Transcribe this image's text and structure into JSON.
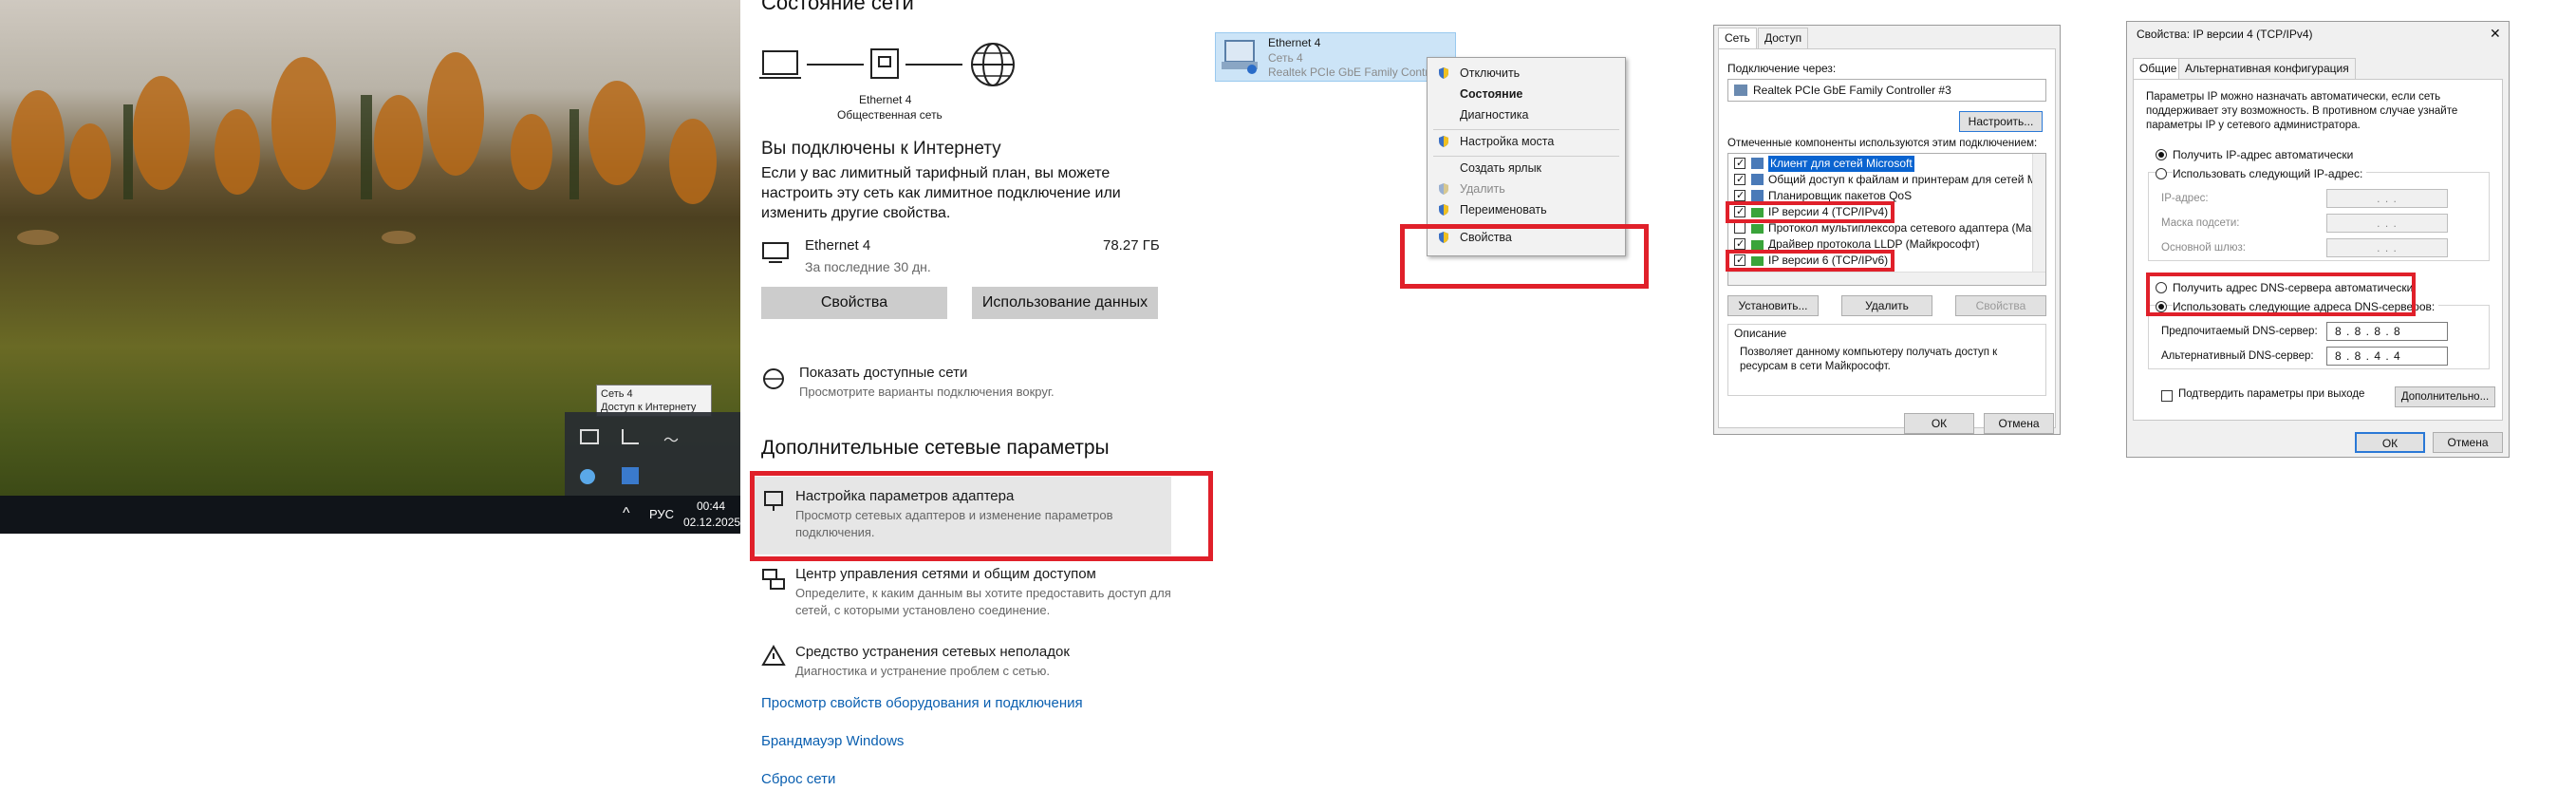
{
  "desktop": {
    "tooltip_line1": "Сеть 4",
    "tooltip_line2": "Доступ к Интернету",
    "lang": "РУС",
    "time": "00:44",
    "date": "02.12.2025"
  },
  "settings": {
    "title": "Состояние сети",
    "adapter_name": "Ethernet 4",
    "network_name": "Общественная сеть",
    "connected_heading": "Вы подключены к Интернету",
    "connected_text": "Если у вас лимитный тарифный план, вы можете настроить эту сеть как лимитное подключение или изменить другие свойства.",
    "usage_name": "Ethernet 4",
    "usage_period": "За последние 30 дн.",
    "usage_amount": "78.27 ГБ",
    "btn_properties": "Свойства",
    "btn_data_usage": "Использование данных",
    "show_networks_title": "Показать доступные сети",
    "show_networks_sub": "Просмотрите варианты подключения вокруг.",
    "advanced_heading": "Дополнительные сетевые параметры",
    "adapter_settings_title": "Настройка параметров адаптера",
    "adapter_settings_sub": "Просмотр сетевых адаптеров и изменение параметров подключения.",
    "sharing_center_title": "Центр управления сетями и общим доступом",
    "sharing_center_sub": "Определите, к каким данным вы хотите предоставить доступ для сетей, с которыми установлено соединение.",
    "troubleshoot_title": "Средство устранения сетевых неполадок",
    "troubleshoot_sub": "Диагностика и устранение проблем с сетью.",
    "links": [
      "Просмотр свойств оборудования и подключения",
      "Брандмауэр Windows",
      "Сброс сети"
    ]
  },
  "explorer": {
    "item_name": "Ethernet 4",
    "item_network": "Сеть 4",
    "item_device": "Realtek PCIe GbE Family Contro"
  },
  "context_menu": {
    "items": [
      "Отключить",
      "Состояние",
      "Диагностика",
      "Настройка моста",
      "Создать ярлык",
      "Удалить",
      "Переименовать",
      "Свойства"
    ]
  },
  "props_dialog": {
    "tabs": [
      "Сеть",
      "Доступ"
    ],
    "connect_via_label": "Подключение через:",
    "device": "Realtek PCIe GbE Family Controller #3",
    "configure_btn": "Настроить...",
    "components_label": "Отмеченные компоненты используются этим подключением:",
    "components": [
      "Клиент для сетей Microsoft",
      "Общий доступ к файлам и принтерам для сетей Mi",
      "Планировщик пакетов QoS",
      "IP версии 4 (TCP/IPv4)",
      "Протокол мультиплексора сетевого адаптера (Ма",
      "Драйвер протокола LLDP (Майкрософт)",
      "IP версии 6 (TCP/IPv6)"
    ],
    "install_btn": "Установить...",
    "remove_btn": "Удалить",
    "properties_btn": "Свойства",
    "description_label": "Описание",
    "description_text": "Позволяет данному компьютеру получать доступ к ресурсам в сети Майкрософт.",
    "ok_btn": "ОК",
    "cancel_btn": "Отмена"
  },
  "ipv4_dialog": {
    "title": "Свойства: IP версии 4 (TCP/IPv4)",
    "tabs": [
      "Общие",
      "Альтернативная конфигурация"
    ],
    "intro": "Параметры IP можно назначать автоматически, если сеть поддерживает эту возможность. В противном случае узнайте параметры IP у сетевого администратора.",
    "auto_ip": "Получить IP-адрес автоматически",
    "manual_ip": "Использовать следующий IP-адрес:",
    "ip_label": "IP-адрес:",
    "mask_label": "Маска подсети:",
    "gateway_label": "Основной шлюз:",
    "empty_ip": ".   .   .",
    "auto_dns": "Получить адрес DNS-сервера автоматически",
    "manual_dns": "Использовать следующие адреса DNS-серверов:",
    "preferred_label": "Предпочитаемый DNS-сервер:",
    "preferred_value": "8 . 8 . 8 . 8",
    "alternate_label": "Альтернативный DNS-сервер:",
    "alternate_value": "8 . 8 . 4 . 4",
    "validate_label": "Подтвердить параметры при выходе",
    "advanced_btn": "Дополнительно...",
    "ok_btn": "ОК",
    "cancel_btn": "Отмена",
    "close_glyph": "✕"
  }
}
